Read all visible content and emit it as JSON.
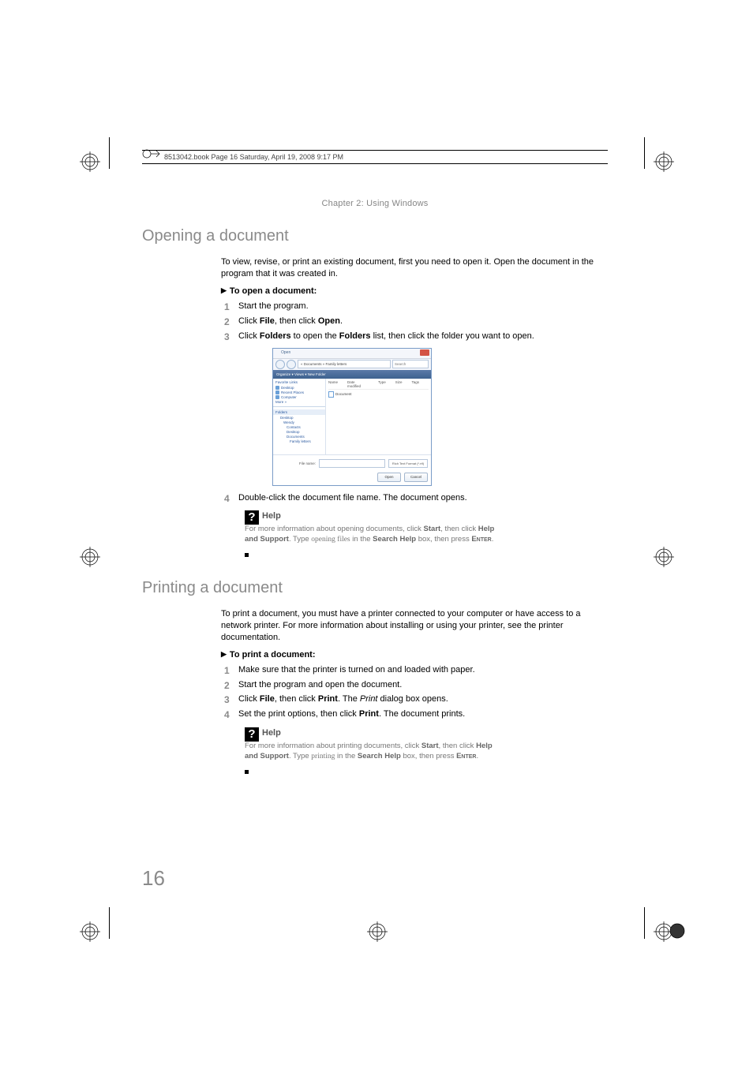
{
  "header": "8513042.book  Page 16  Saturday, April 19, 2008  9:17 PM",
  "chapter": "Chapter 2: Using Windows",
  "page_number": "16",
  "section1": {
    "title": "Opening a document",
    "intro": "To view, revise, or print an existing document, first you need to open it. Open the document in the program that it was created in.",
    "proc_title": "To open a document:",
    "steps": {
      "s1": "Start the program.",
      "s2_pre": "Click ",
      "s2_b1": "File",
      "s2_mid": ", then click ",
      "s2_b2": "Open",
      "s2_post": ".",
      "s3_pre": "Click ",
      "s3_b1": "Folders",
      "s3_mid": " to open the ",
      "s3_b2": "Folders",
      "s3_post": " list, then click the folder you want to open.",
      "s4": "Double-click the document file name. The document opens."
    }
  },
  "help1": {
    "title": "Help",
    "l1_pre": "For more information about opening documents, click ",
    "l1_b1": "Start",
    "l1_mid": ", then click ",
    "l1_b2": "Help and Support",
    "l1_post": ". Type ",
    "l1_kw": "opening files",
    "l1_in": " in the ",
    "l1_b3": "Search Help",
    "l1_box": " box, then press ",
    "l1_enter": "Enter",
    "l1_end": "."
  },
  "section2": {
    "title": "Printing a document",
    "intro": "To print a document, you must have a printer connected to your computer or have access to a network printer. For more information about installing or using your printer, see the printer documentation.",
    "proc_title": "To print a document:",
    "steps": {
      "s1": "Make sure that the printer is turned on and loaded with paper.",
      "s2": "Start the program and open the document.",
      "s3_pre": "Click ",
      "s3_b1": "File",
      "s3_mid": ", then click ",
      "s3_b2": "Print",
      "s3_post1": ". The ",
      "s3_i": "Print",
      "s3_post2": " dialog box opens.",
      "s4_pre": "Set the print options, then click ",
      "s4_b1": "Print",
      "s4_post": ". The document prints."
    }
  },
  "help2": {
    "title": "Help",
    "l1_pre": "For more information about printing documents, click ",
    "l1_b1": "Start",
    "l1_mid": ", then click ",
    "l1_b2": "Help and Support",
    "l1_post": ". Type ",
    "l1_kw": "printing",
    "l1_in": " in the ",
    "l1_b3": "Search Help",
    "l1_box": " box, then press ",
    "l1_enter": "Enter",
    "l1_end": "."
  },
  "dialog": {
    "title": "Open",
    "crumb": "« Documents » Family letters",
    "search_ph": "Search",
    "toolbar": "Organize ▾   Views ▾   New Folder",
    "fav_head": "Favorite Links",
    "fav1": "Desktop",
    "fav2": "Recent Places",
    "fav3": "Computer",
    "fav_more": "More »",
    "folders_hdr": "Folders",
    "tree1": "Desktop",
    "tree2": "Wendy",
    "tree3": "Contacts",
    "tree4": "Desktop",
    "tree5": "Documents",
    "tree6": "Family letters",
    "col_name": "Name",
    "col_date": "Date modified",
    "col_type": "Type",
    "col_size": "Size",
    "col_tags": "Tags",
    "file1": "Document",
    "fn_label": "File name:",
    "filter": "Rich Text Format (*.rtf)",
    "btn_open": "Open",
    "btn_cancel": "Cancel"
  }
}
